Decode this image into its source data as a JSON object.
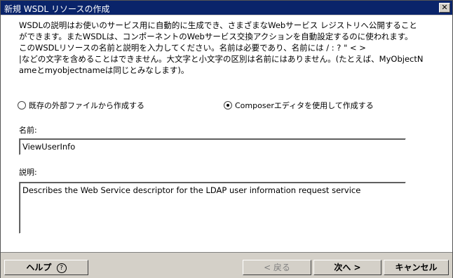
{
  "window": {
    "title": "新規 WSDL リソースの作成",
    "close_glyph": "✕"
  },
  "description": {
    "lines": [
      "WSDLの説明はお使いのサービス用に自動的に生成でき、さまざまなWebサービス レジストリへ公開すること",
      "ができます。またWSDLは、コンポーネントのWebサービス交換アクションを自動設定するのに使われます。",
      "このWSDLリソースの名前と説明を入力してください。名前は必要であり、名前には / : ? \" < >",
      "|などの文字を含めることはできません。大文字と小文字の区別は名前にはありません。(たとえば、MyObjectN",
      "ameとmyobjectnameは同じとみなします)。"
    ]
  },
  "options": {
    "existing_file_label": "既存の外部ファイルから作成する",
    "composer_label": "Composerエディタを使用して作成する",
    "selected": "composer"
  },
  "form": {
    "name_label": "名前:",
    "name_value": "ViewUserInfo",
    "description_label": "説明:",
    "description_value": "Describes the Web Service descriptor for the LDAP user information request service"
  },
  "footer": {
    "help_label": "ヘルプ",
    "help_icon": "?",
    "back_label": "< 戻る",
    "next_label": "次へ >",
    "cancel_label": "キャンセル"
  }
}
